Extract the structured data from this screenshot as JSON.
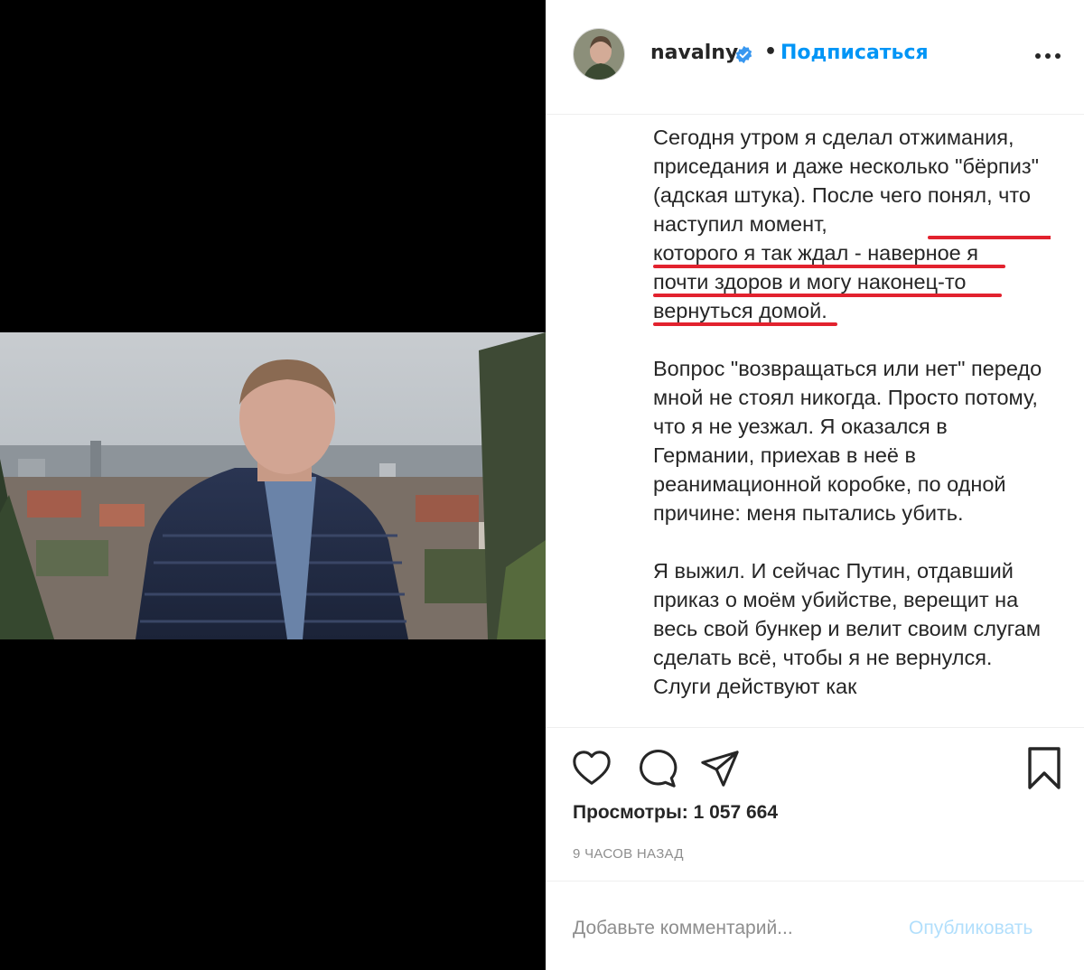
{
  "post": {
    "username": "navalny",
    "separator": "•",
    "follow_label": "Подписаться",
    "more_icon": "more-horizontal-icon",
    "verified_icon": "verified-badge-icon"
  },
  "caption": {
    "p1_lead": "Сегодня утром я сделал отжимания, приседания и даже несколько \"бёрпиз\" (адская штука). После чего ",
    "p1_l1": "понял, что наступил момент,",
    "p1_l2": "которого я так ждал - наверное я",
    "p1_l3": "почти здоров и могу наконец-то",
    "p1_l4": "вернуться домой",
    "p1_end": ".",
    "p2": "Вопрос \"возвращаться или нет\" передо мной не стоял никогда. Просто потому, что я не уезжал. Я оказался в Германии, приехав в неё в реанимационной коробке, по одной причине: меня пытались убить.",
    "p3": "Я выжил. И сейчас Путин, отдавший приказ о моём убийстве, верещит на весь свой бункер и велит своим слугам сделать всё, чтобы я не вернулся. Слуги действуют как"
  },
  "actions": {
    "like_icon": "heart-icon",
    "comment_icon": "comment-icon",
    "share_icon": "send-icon",
    "save_icon": "bookmark-icon",
    "views_label": "Просмотры: 1 057 664",
    "time_ago": "9 ЧАСОВ НАЗАД"
  },
  "comment_box": {
    "placeholder": "Добавьте комментарий...",
    "publish_label": "Опубликовать"
  },
  "colors": {
    "accent": "#0095f6",
    "publish_disabled": "#b2dffc",
    "highlight_underline": "#e2222e",
    "secondary_text": "#8e8e8e"
  }
}
